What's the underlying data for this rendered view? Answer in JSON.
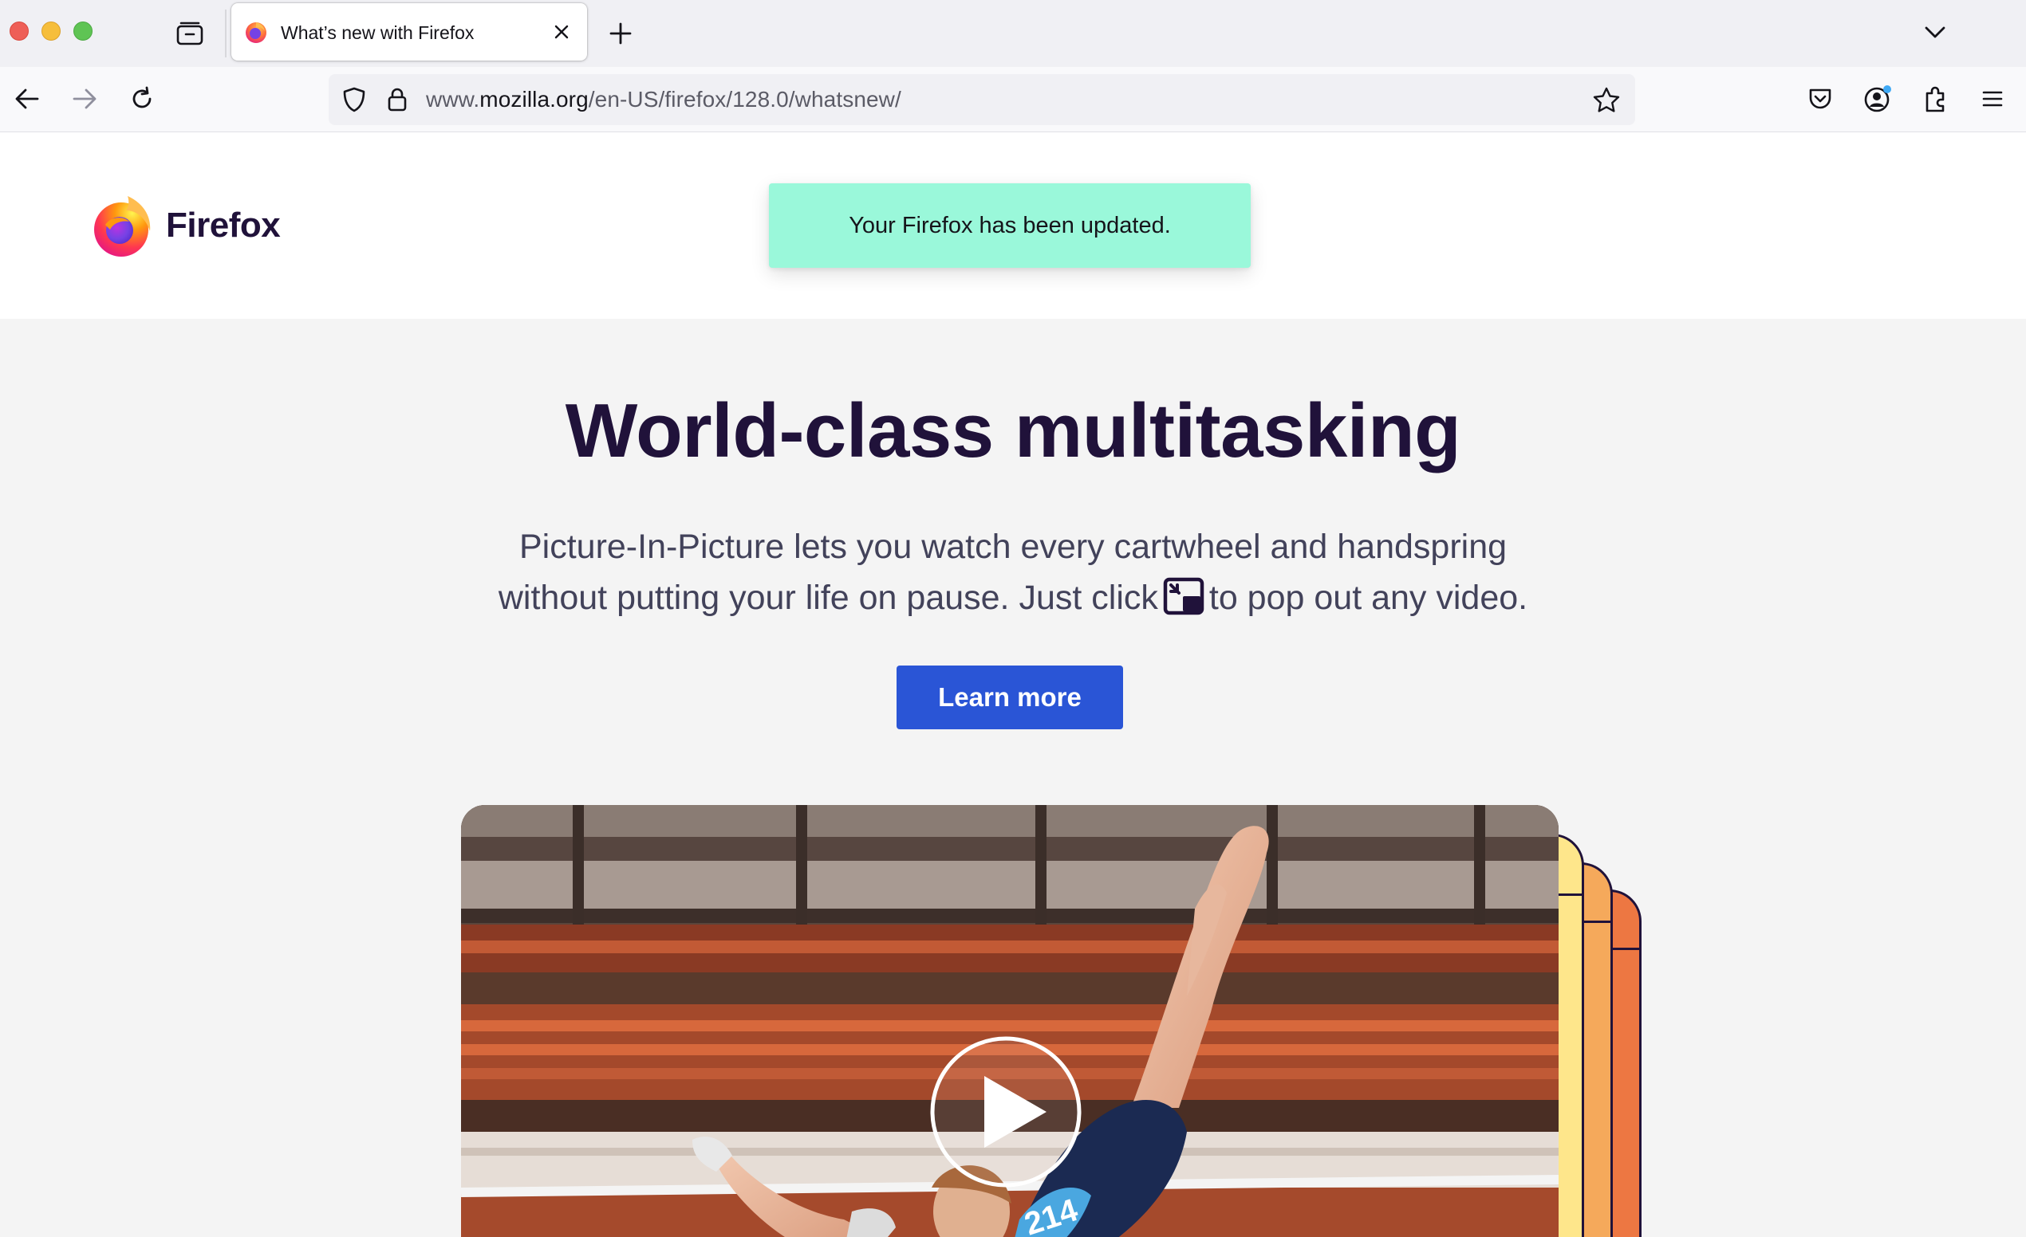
{
  "browser": {
    "tab": {
      "title": "What’s new with Firefox"
    },
    "url": {
      "prefix": "www.",
      "domain": "mozilla.org",
      "path": "/en-US/firefox/128.0/whatsnew/"
    }
  },
  "page": {
    "logo_text": "Firefox",
    "notification": "Your Firefox has been updated.",
    "hero": {
      "title": "World-class multitasking",
      "body_line1": "Picture-In-Picture lets you watch every cartwheel and handspring",
      "body_line2_before": "without putting your life on pause. Just click",
      "body_line2_after": "to pop out any video.",
      "cta_label": "Learn more"
    },
    "video": {
      "bib_number": "214"
    }
  },
  "colors": {
    "accent": "#2a55d6",
    "notification_bg": "#9af8da",
    "heading": "#20123a",
    "stack_yellow": "#fee68b",
    "stack_orange": "#f5a95b",
    "stack_red": "#ed7742"
  },
  "icons": {
    "tab_list": "tab-list-icon",
    "close": "close-icon",
    "new_tab": "plus-icon",
    "list_all_tabs": "chevron-down-icon",
    "back": "back-arrow-icon",
    "forward": "forward-arrow-icon",
    "reload": "reload-icon",
    "tracking_protection": "shield-icon",
    "security": "lock-icon",
    "bookmark": "star-icon",
    "pocket": "pocket-icon",
    "account": "account-icon",
    "extensions": "puzzle-icon",
    "menu": "hamburger-menu-icon",
    "pip": "picture-in-picture-icon",
    "play": "play-icon"
  }
}
